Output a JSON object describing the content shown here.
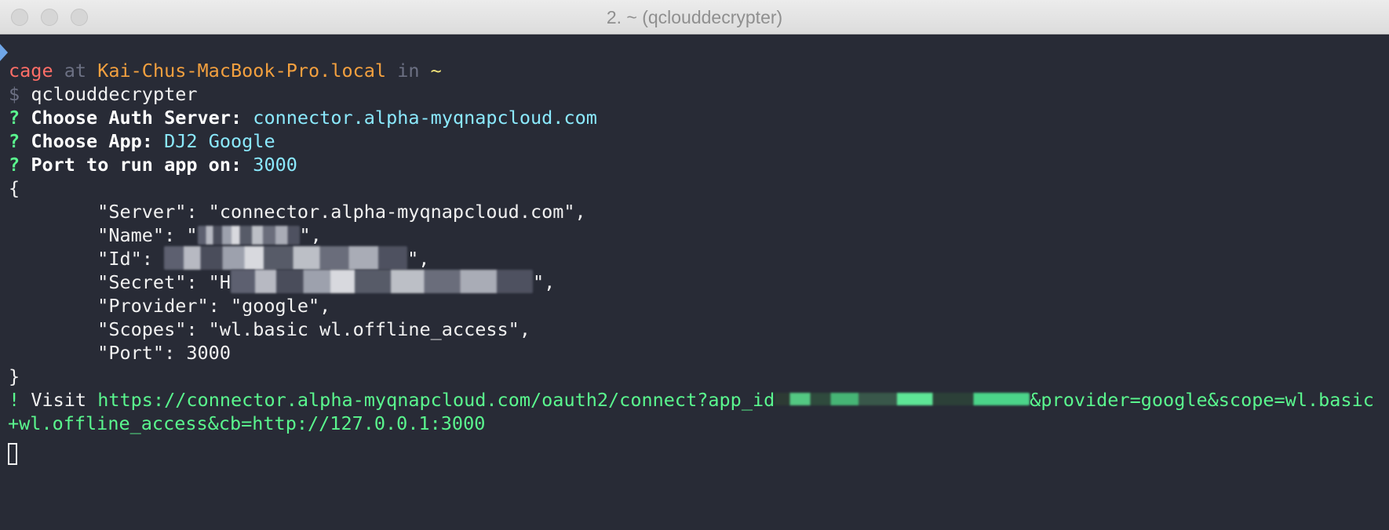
{
  "window": {
    "title": "2. ~ (qclouddecrypter)"
  },
  "prompt": {
    "user": "cage",
    "at": "at",
    "host": "Kai-Chus-MacBook-Pro.local",
    "in": "in",
    "dir": "~",
    "dollar": "$",
    "command": "qclouddecrypter"
  },
  "questions": [
    {
      "mark": "?",
      "label": "Choose Auth Server:",
      "answer": "connector.alpha-myqnapcloud.com"
    },
    {
      "mark": "?",
      "label": "Choose App:",
      "answer": "DJ2 Google"
    },
    {
      "mark": "?",
      "label": "Port to run app on:",
      "answer": "3000"
    }
  ],
  "json_output": {
    "open_brace": "{",
    "server": "        \"Server\": \"connector.alpha-myqnapcloud.com\",",
    "name_prefix": "        \"Name\": \"",
    "name_suffix": "\",",
    "id_prefix": "        \"Id\": ",
    "id_suffix": "\",",
    "secret_prefix": "        \"Secret\": \"H",
    "secret_suffix": "\",",
    "provider": "        \"Provider\": \"google\",",
    "scopes": "        \"Scopes\": \"wl.basic wl.offline_access\",",
    "port": "        \"Port\": 3000",
    "close_brace": "}"
  },
  "visit": {
    "mark": "!",
    "label": "Visit",
    "url_part1": "https://connector.alpha-myqnapcloud.com/oauth2/connect?app_id",
    "url_part2": "&provider=google&scope=wl.basic",
    "url_part3": "+wl.offline_access&cb=http://127.0.0.1:3000"
  },
  "colors": {
    "background": "#282b36",
    "user": "#ff6e67",
    "host": "#f3a03f",
    "link": "#5af78e",
    "answer": "#8be9fd"
  }
}
